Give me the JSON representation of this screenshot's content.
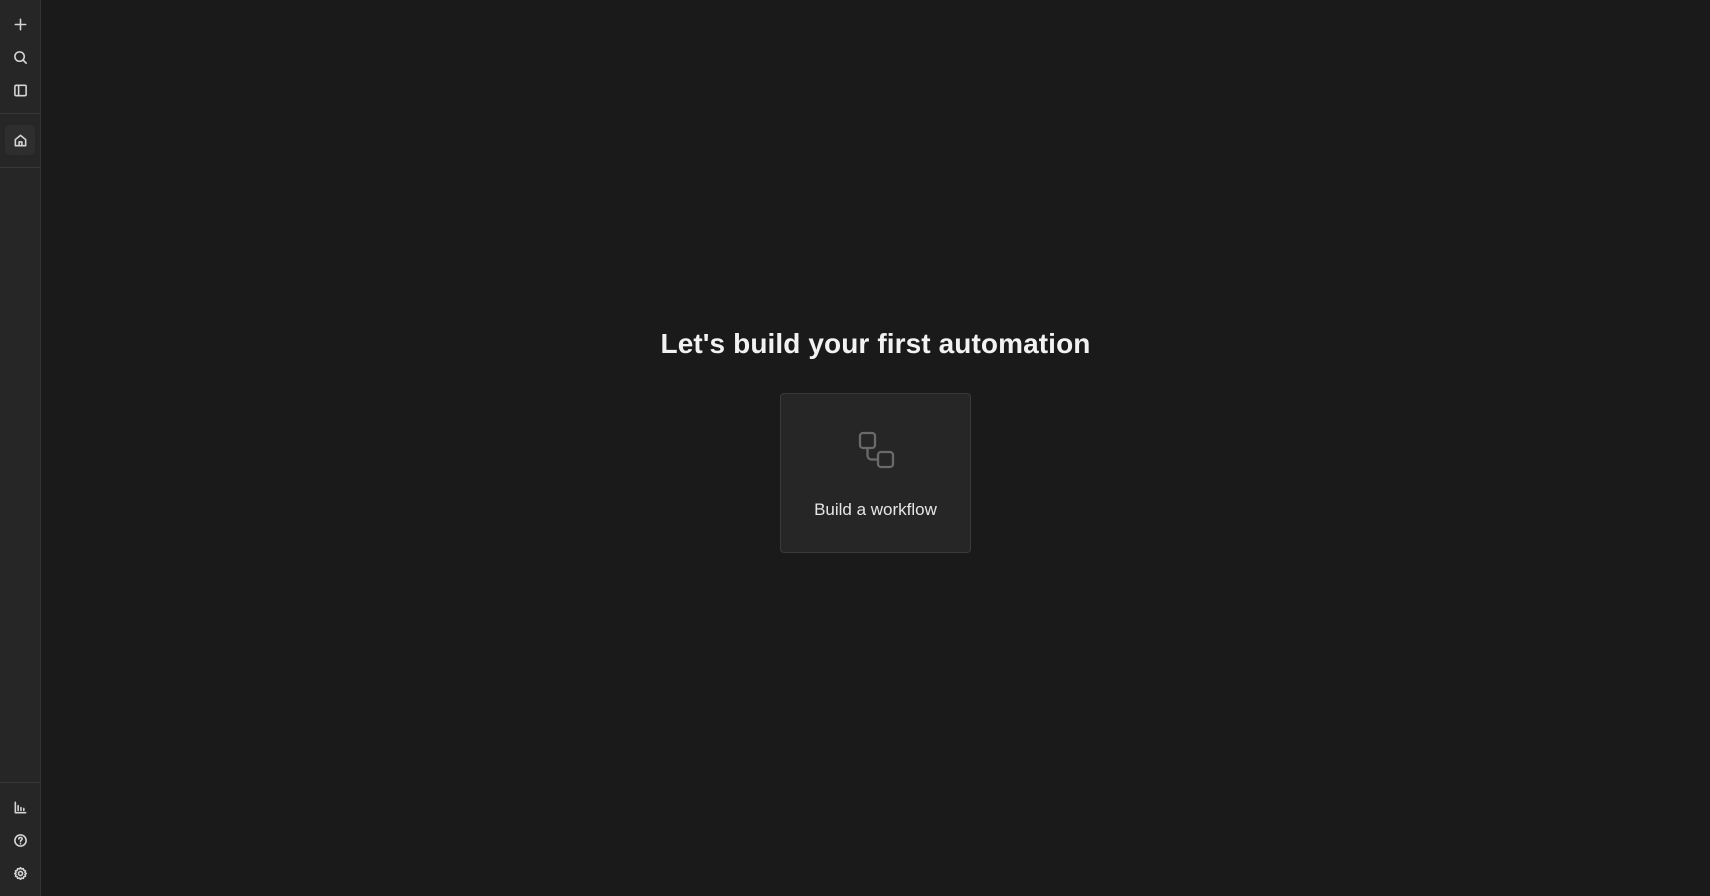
{
  "sidebar": {
    "top_items": [
      {
        "icon": "plus-icon"
      },
      {
        "icon": "search-icon"
      },
      {
        "icon": "sidebar-toggle-icon"
      }
    ],
    "home_item": {
      "icon": "home-icon",
      "active": true
    },
    "bottom_items": [
      {
        "icon": "chart-icon"
      },
      {
        "icon": "help-icon"
      },
      {
        "icon": "gear-icon"
      }
    ]
  },
  "main": {
    "headline": "Let's build your first automation",
    "card": {
      "icon": "workflow-icon",
      "label": "Build a workflow"
    }
  },
  "colors": {
    "background": "#1a1a1a",
    "sidebar": "#262626",
    "card": "#262626",
    "text": "#f2f2f2"
  }
}
